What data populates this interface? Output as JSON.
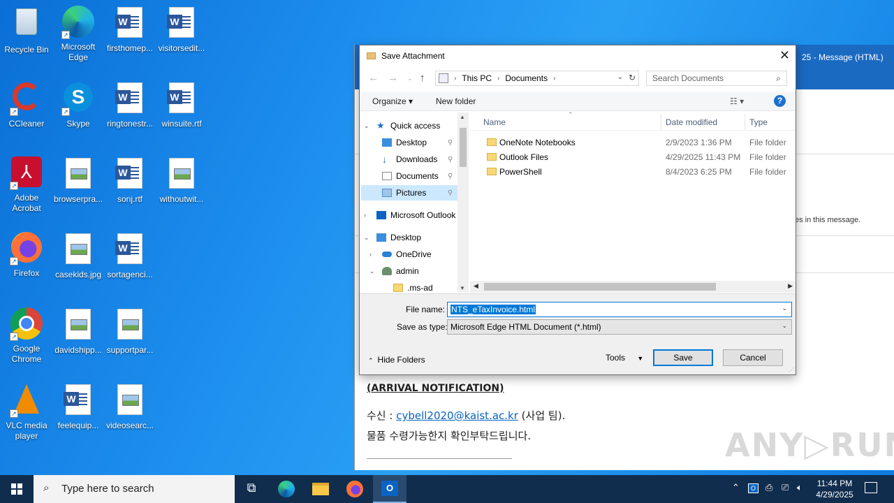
{
  "desktop": {
    "icons": [
      {
        "label": "Recycle Bin",
        "icon": "recycle-bin-icon"
      },
      {
        "label": "Microsoft Edge",
        "icon": "edge-icon"
      },
      {
        "label": "firsthomep...",
        "icon": "word-doc-icon"
      },
      {
        "label": "visitorsedit...",
        "icon": "word-doc-icon"
      },
      {
        "label": "CCleaner",
        "icon": "ccleaner-icon"
      },
      {
        "label": "Skype",
        "icon": "skype-icon"
      },
      {
        "label": "ringtonestr...",
        "icon": "word-doc-icon"
      },
      {
        "label": "winsuite.rtf",
        "icon": "word-doc-icon"
      },
      {
        "label": "Adobe Acrobat",
        "icon": "acrobat-icon"
      },
      {
        "label": "browserpra...",
        "icon": "image-file-icon"
      },
      {
        "label": "sonj.rtf",
        "icon": "word-doc-icon"
      },
      {
        "label": "withoutwit...",
        "icon": "image-file-icon"
      },
      {
        "label": "Firefox",
        "icon": "firefox-icon"
      },
      {
        "label": "casekids.jpg",
        "icon": "image-file-icon"
      },
      {
        "label": "sortagenci...",
        "icon": "word-doc-icon"
      },
      {
        "label": "Google Chrome",
        "icon": "chrome-icon"
      },
      {
        "label": "davidshipp...",
        "icon": "image-file-icon"
      },
      {
        "label": "supportpar...",
        "icon": "image-file-icon"
      },
      {
        "label": "VLC media player",
        "icon": "vlc-icon"
      },
      {
        "label": "feelequip...",
        "icon": "word-doc-icon"
      },
      {
        "label": "videosearc...",
        "icon": "image-file-icon"
      }
    ]
  },
  "outlook": {
    "title_fragment": "25  -  Message (HTML)",
    "info_fragment": "es in this message.",
    "body": {
      "heading": "(ARRIVAL NOTIFICATION)",
      "to_prefix": "수신 : ",
      "email": "cybell2020@kaist.ac.kr",
      "to_suffix": " (사업 팀).",
      "line2": "물품 수령가능한지 확인부탁드립니다."
    }
  },
  "dialog": {
    "title": "Save Attachment",
    "close": "✕",
    "address": {
      "root": "This PC",
      "folder": "Documents"
    },
    "search_placeholder": "Search Documents",
    "toolbar": {
      "organize": "Organize ▾",
      "new_folder": "New folder",
      "view": "☷ ▾",
      "help": "?"
    },
    "nav": [
      {
        "label": "Quick access",
        "icon": "star-icon",
        "twisty": "⌄"
      },
      {
        "label": "Desktop",
        "icon": "desktop-icon",
        "pin": "📌"
      },
      {
        "label": "Downloads",
        "icon": "download-icon",
        "pin": "📌"
      },
      {
        "label": "Documents",
        "icon": "documents-icon",
        "pin": "📌"
      },
      {
        "label": "Pictures",
        "icon": "pictures-icon",
        "pin": "📌"
      },
      {
        "label": "Microsoft Outlook",
        "icon": "outlook-icon",
        "twisty": "›"
      },
      {
        "label": "Desktop",
        "icon": "desktop-icon",
        "twisty": "⌄"
      },
      {
        "label": "OneDrive",
        "icon": "cloud-icon",
        "twisty": "›"
      },
      {
        "label": "admin",
        "icon": "user-icon",
        "twisty": "⌄"
      },
      {
        "label": ".ms-ad",
        "icon": "folder-icon"
      }
    ],
    "columns": {
      "name": "Name",
      "date": "Date modified",
      "type": "Type"
    },
    "files": [
      {
        "name": "OneNote Notebooks",
        "date": "2/9/2023 1:36 PM",
        "type": "File folder"
      },
      {
        "name": "Outlook Files",
        "date": "4/29/2025 11:43 PM",
        "type": "File folder"
      },
      {
        "name": "PowerShell",
        "date": "8/4/2023 6:25 PM",
        "type": "File folder"
      }
    ],
    "form": {
      "file_name_label": "File name:",
      "file_name_value": "NTS_eTaxInvoice.html",
      "save_type_label": "Save as type:",
      "save_type_value": "Microsoft Edge HTML Document (*.html)",
      "hide_folders": "Hide Folders",
      "tools": "Tools",
      "save": "Save",
      "cancel": "Cancel"
    }
  },
  "watermark": "ANY▷RUN",
  "taskbar": {
    "search_placeholder": "Type here to search",
    "time": "11:44 PM",
    "date": "4/29/2025"
  }
}
